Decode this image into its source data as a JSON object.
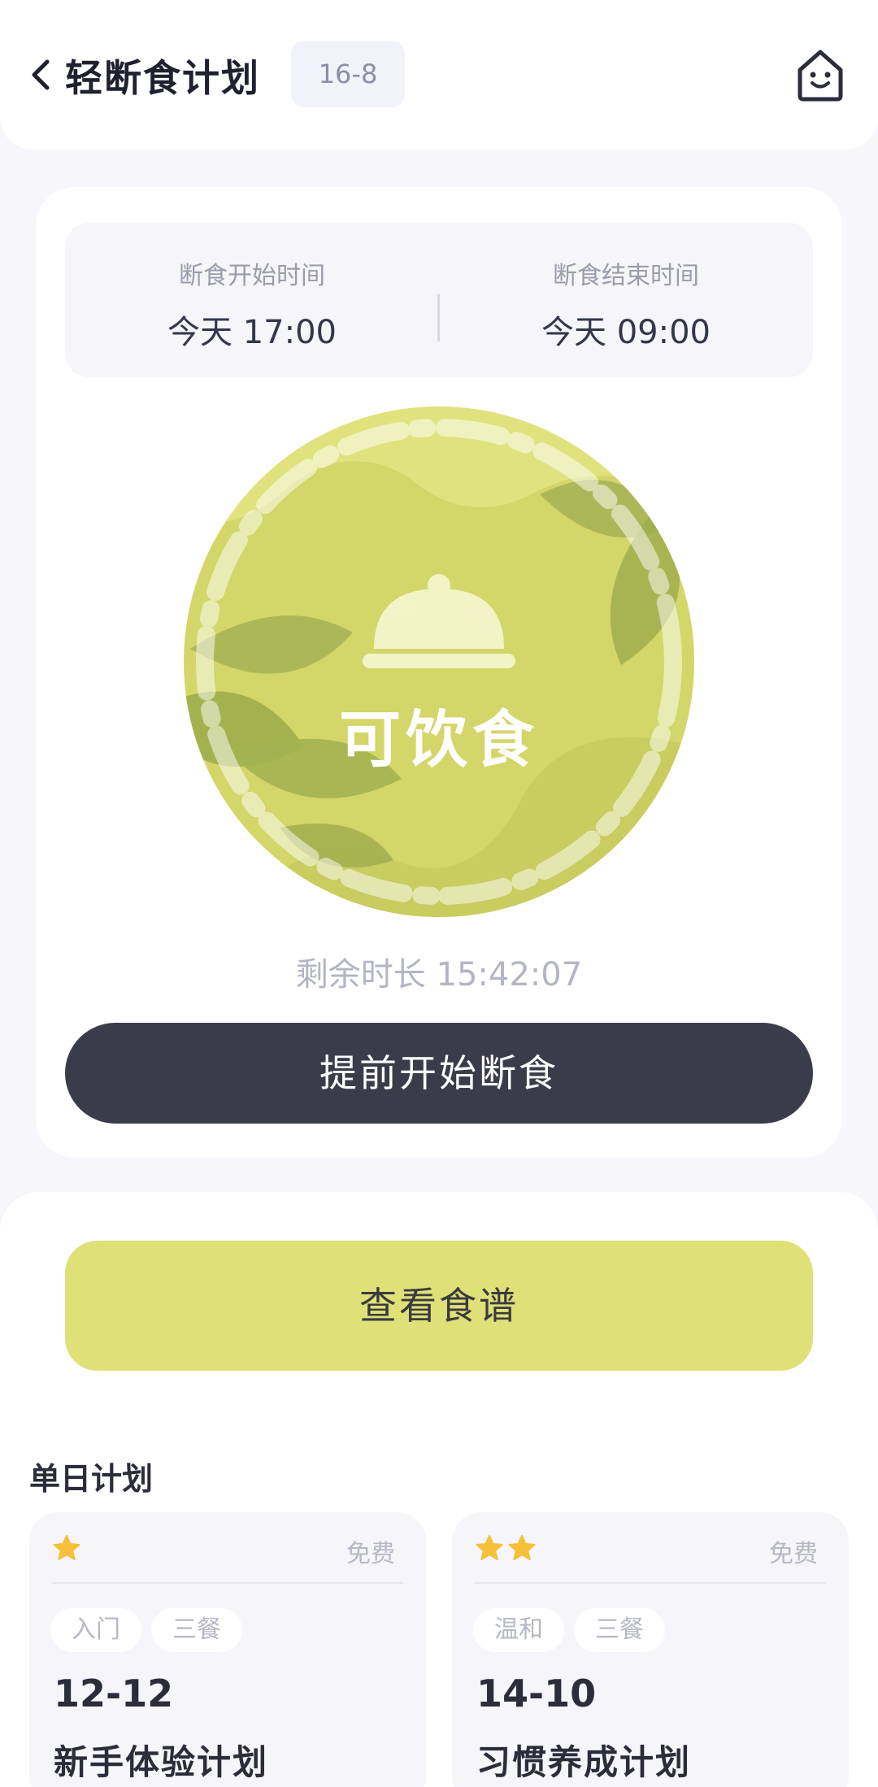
{
  "header": {
    "title": "轻断食计划",
    "plan_badge": "16-8"
  },
  "fasting": {
    "start_label": "断食开始时间",
    "start_value": "今天 17:00",
    "end_label": "断食结束时间",
    "end_value": "今天 09:00",
    "status": "可饮食",
    "remaining": "剩余时长 15:42:07",
    "start_early_button": "提前开始断食"
  },
  "recipe_button": "查看食谱",
  "daily_plans": {
    "title": "单日计划",
    "items": [
      {
        "stars": 1,
        "price": "免费",
        "tags": [
          "入门",
          "三餐"
        ],
        "ratio": "12-12",
        "name": "新手体验计划"
      },
      {
        "stars": 2,
        "price": "免费",
        "tags": [
          "温和",
          "三餐"
        ],
        "ratio": "14-10",
        "name": "习惯养成计划"
      }
    ]
  },
  "colors": {
    "accent_yellow": "#dfe077",
    "dark_button": "#3b3c4b",
    "star": "#f6c03a",
    "circle_fill": "#d3d668"
  },
  "icons": [
    "chevron-left-icon",
    "smiley-house-icon",
    "food-cloche-icon",
    "star-icon"
  ]
}
